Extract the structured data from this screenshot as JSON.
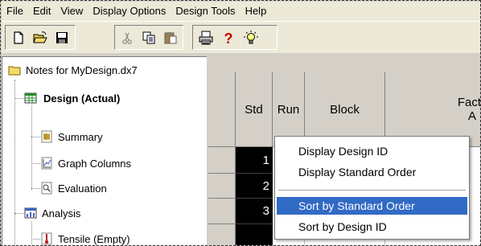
{
  "menubar": {
    "items": [
      "File",
      "Edit",
      "View",
      "Display Options",
      "Design Tools",
      "Help"
    ]
  },
  "toolbar": {
    "buttons": [
      "new-file-icon",
      "open-folder-icon",
      "save-icon",
      "cut-icon",
      "copy-icon",
      "paste-icon",
      "print-icon",
      "help-icon",
      "tip-bulb-icon"
    ]
  },
  "tree": {
    "root": "Notes for MyDesign.dx7",
    "design": "Design (Actual)",
    "summary": "Summary",
    "graph_columns": "Graph Columns",
    "evaluation": "Evaluation",
    "analysis": "Analysis",
    "tensile": "Tensile (Empty)"
  },
  "grid": {
    "headers": {
      "std": "Std",
      "run": "Run",
      "block": "Block",
      "factor_line1": "Fact",
      "factor_line2": "A"
    },
    "std_values": [
      "1",
      "2",
      "3"
    ]
  },
  "context_menu": {
    "items": [
      "Display Design ID",
      "Display Standard Order",
      "Sort by Standard Order",
      "Sort by Design ID"
    ],
    "highlighted_index": 2
  },
  "colors": {
    "highlight": "#316ac5",
    "chrome": "#ece9d8",
    "grid_header": "#d4d0c8"
  }
}
